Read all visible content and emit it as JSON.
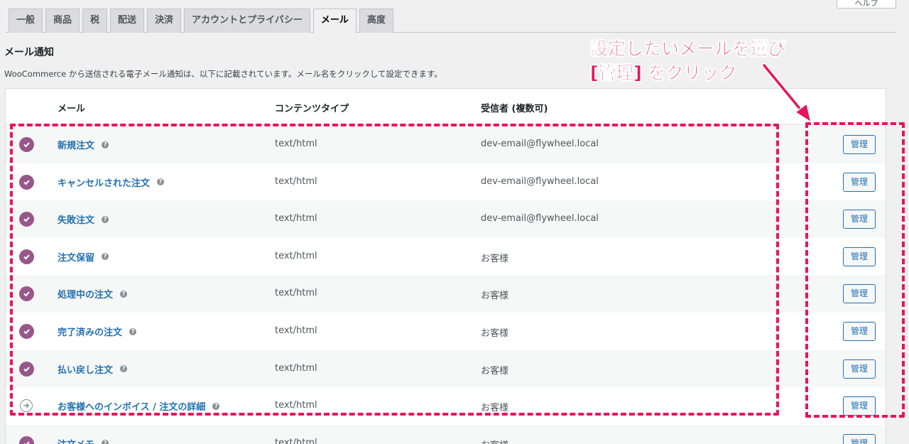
{
  "header": {
    "help_label": "ヘルプ"
  },
  "tabs": [
    {
      "label": "一般",
      "active": false
    },
    {
      "label": "商品",
      "active": false
    },
    {
      "label": "税",
      "active": false
    },
    {
      "label": "配送",
      "active": false
    },
    {
      "label": "決済",
      "active": false
    },
    {
      "label": "アカウントとプライバシー",
      "active": false
    },
    {
      "label": "メール",
      "active": true
    },
    {
      "label": "高度",
      "active": false
    }
  ],
  "section": {
    "title": "メール通知",
    "description": "WooCommerce から送信される電子メール通知は、以下に記載されています。メール名をクリックして設定できます。"
  },
  "table": {
    "columns": {
      "email": "メール",
      "content_type": "コンテンツタイプ",
      "recipient": "受信者 (複数可)"
    },
    "manage_label": "管理",
    "rows": [
      {
        "name": "新規注文",
        "content_type": "text/html",
        "recipient": "dev-email@flywheel.local",
        "status": "enabled"
      },
      {
        "name": "キャンセルされた注文",
        "content_type": "text/html",
        "recipient": "dev-email@flywheel.local",
        "status": "enabled"
      },
      {
        "name": "失敗注文",
        "content_type": "text/html",
        "recipient": "dev-email@flywheel.local",
        "status": "enabled"
      },
      {
        "name": "注文保留",
        "content_type": "text/html",
        "recipient": "お客様",
        "status": "enabled"
      },
      {
        "name": "処理中の注文",
        "content_type": "text/html",
        "recipient": "お客様",
        "status": "enabled"
      },
      {
        "name": "完了済みの注文",
        "content_type": "text/html",
        "recipient": "お客様",
        "status": "enabled"
      },
      {
        "name": "払い戻し注文",
        "content_type": "text/html",
        "recipient": "お客様",
        "status": "enabled"
      },
      {
        "name": "お客様へのインボイス / 注文の詳細",
        "content_type": "text/html",
        "recipient": "お客様",
        "status": "manual"
      },
      {
        "name": "注文メモ",
        "content_type": "text/html",
        "recipient": "お客様",
        "status": "enabled"
      }
    ]
  },
  "annotation": {
    "line1": "設定したいメールを選び",
    "line2": "[管理] をクリック",
    "color": "#e8155a"
  },
  "colors": {
    "accent": "#2271b1",
    "status_enabled": "#96588a"
  }
}
